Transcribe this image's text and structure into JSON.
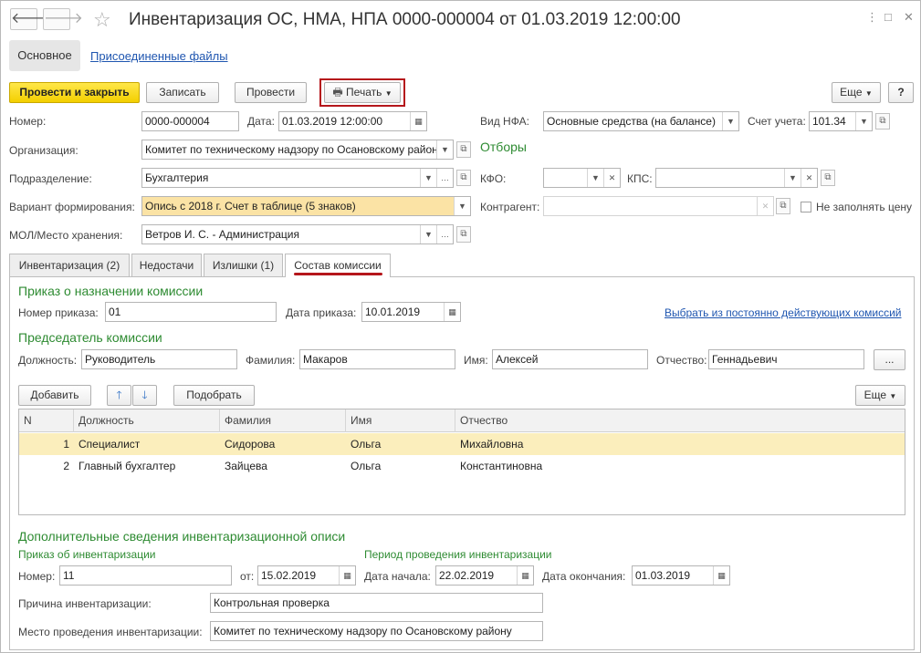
{
  "window": {
    "title": "Инвентаризация ОС, НМА, НПА 0000-000004 от 01.03.2019 12:00:00",
    "back_icon": "arrow-left",
    "forward_icon": "arrow-right",
    "star_icon": "star",
    "controls": [
      "⋮",
      "□",
      "✕"
    ]
  },
  "top_tabs": {
    "main": "Основное",
    "attached": "Присоединенные файлы"
  },
  "toolbar": {
    "post_close": "Провести и закрыть",
    "save": "Записать",
    "post": "Провести",
    "print": "Печать",
    "more": "Еще",
    "help": "?"
  },
  "header": {
    "number_label": "Номер:",
    "number": "0000-000004",
    "date_label": "Дата:",
    "date": "01.03.2019 12:00:00",
    "nfa_type_label": "Вид НФА:",
    "nfa_type": "Основные средства (на балансе)",
    "account_label": "Счет учета:",
    "account": "101.34",
    "org_label": "Организация:",
    "org": "Комитет по техническому надзору по Осановскому району",
    "filters_title": "Отборы",
    "subdivision_label": "Подразделение:",
    "subdivision": "Бухгалтерия",
    "kfo_label": "КФО:",
    "kfo": "",
    "kps_label": "КПС:",
    "kps": "",
    "variant_label": "Вариант формирования:",
    "variant": "Опись с 2018 г. Счет в таблице (5 знаков)",
    "contractor_label": "Контрагент:",
    "contractor": "",
    "no_price_label": "Не заполнять цену",
    "mol_label": "МОЛ/Место хранения:",
    "mol": "Ветров И. С. - Администрация"
  },
  "doc_tabs": [
    "Инвентаризация (2)",
    "Недостачи",
    "Излишки (1)",
    "Состав комиссии"
  ],
  "commission": {
    "order_title": "Приказ о назначении комиссии",
    "order_number_label": "Номер приказа:",
    "order_number": "01",
    "order_date_label": "Дата приказа:",
    "order_date": "10.01.2019",
    "select_link": "Выбрать из постоянно действующих комиссий",
    "chair_title": "Председатель комиссии",
    "position_label": "Должность:",
    "position": "Руководитель",
    "surname_label": "Фамилия:",
    "surname": "Макаров",
    "name_label": "Имя:",
    "name": "Алексей",
    "patronymic_label": "Отчество:",
    "patronymic": "Геннадьевич",
    "dots": "...",
    "add_btn": "Добавить",
    "pick_btn": "Подобрать",
    "more_btn": "Еще"
  },
  "table": {
    "columns": [
      "N",
      "Должность",
      "Фамилия",
      "Имя",
      "Отчество"
    ],
    "rows": [
      {
        "n": "1",
        "position": "Специалист",
        "surname": "Сидорова",
        "name": "Ольга",
        "patronymic": "Михайловна"
      },
      {
        "n": "2",
        "position": "Главный бухгалтер",
        "surname": "Зайцева",
        "name": "Ольга",
        "patronymic": "Константиновна"
      }
    ]
  },
  "additional": {
    "title": "Дополнительные сведения инвентаризационной описи",
    "order_title": "Приказ об инвентаризации",
    "period_title": "Период проведения инвентаризации",
    "number_label": "Номер:",
    "number": "11",
    "from_label": "от:",
    "from_date": "15.02.2019",
    "start_label": "Дата начала:",
    "start_date": "22.02.2019",
    "end_label": "Дата окончания:",
    "end_date": "01.03.2019",
    "reason_label": "Причина инвентаризации:",
    "reason": "Контрольная проверка",
    "place_label": "Место проведения инвентаризации:",
    "place": "Комитет по техническому надзору по Осановскому району"
  },
  "colors": {
    "accent_green": "#2e8b32",
    "link_blue": "#1f56b0",
    "yellow_button": "#f3cf00",
    "highlight_red": "#b5161b",
    "selected_row": "#fbeebc"
  }
}
